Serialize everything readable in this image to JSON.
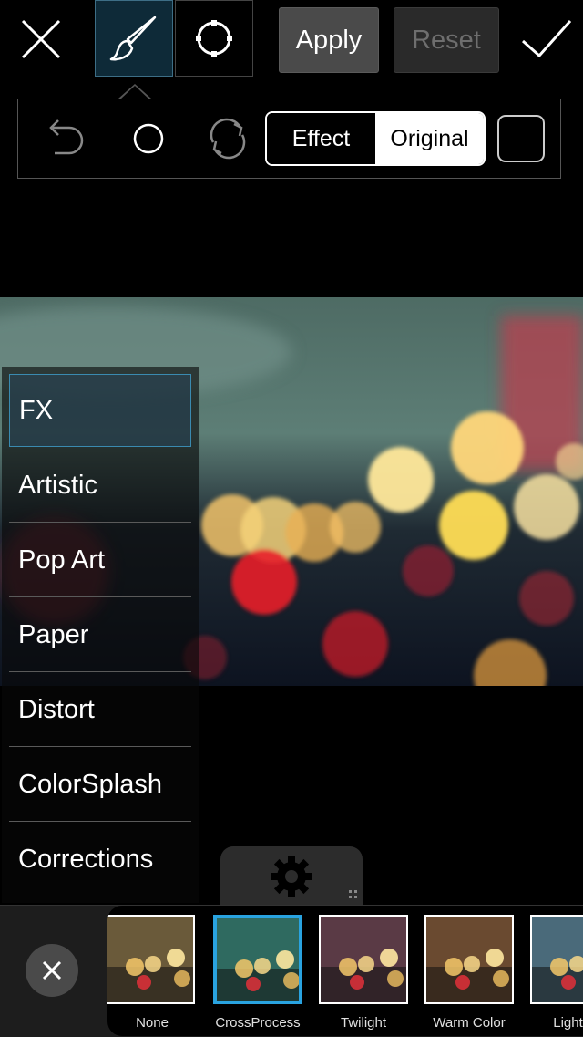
{
  "toolbar": {
    "close_icon": "close-icon",
    "brush_icon": "brush-icon",
    "circle_select_icon": "circle-select-icon",
    "apply_label": "Apply",
    "reset_label": "Reset",
    "confirm_icon": "checkmark-icon"
  },
  "tool_panel": {
    "undo_icon": "undo-icon",
    "circle_icon": "circle-icon",
    "refresh_icon": "refresh-icon",
    "toggle": {
      "effect_label": "Effect",
      "original_label": "Original",
      "selected": "Original"
    },
    "square_icon": "square-icon"
  },
  "menu": {
    "items": [
      {
        "label": "FX",
        "selected": true
      },
      {
        "label": "Artistic"
      },
      {
        "label": "Pop Art"
      },
      {
        "label": "Paper"
      },
      {
        "label": "Distort"
      },
      {
        "label": "ColorSplash"
      },
      {
        "label": "Corrections"
      }
    ]
  },
  "settings_icon": "gear-icon",
  "filters": {
    "close_icon": "close-icon",
    "selected": "CrossProcess",
    "items": [
      {
        "label": "None",
        "tint": "#6a5a3a"
      },
      {
        "label": "CrossProcess",
        "tint": "#2f6a60"
      },
      {
        "label": "Twilight",
        "tint": "#5a3a45"
      },
      {
        "label": "Warm Color",
        "tint": "#6a4a30"
      },
      {
        "label": "Light C",
        "tint": "#4a6a7a"
      }
    ]
  },
  "colors": {
    "accent": "#29a3e0",
    "background": "#000000"
  }
}
